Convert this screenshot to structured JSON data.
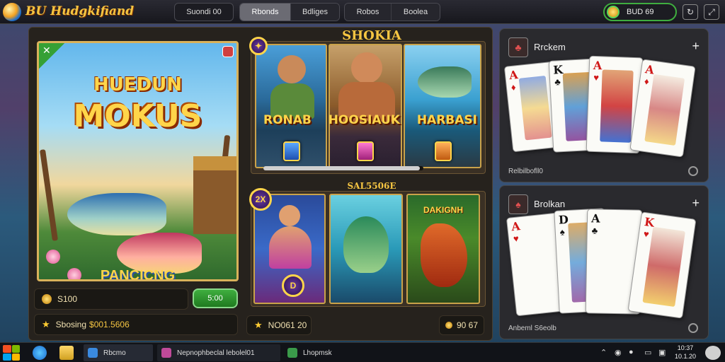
{
  "topbar": {
    "app_name": "BU Hudgkifiand",
    "search_label": "Suondi 00",
    "tabs": [
      "Rbonds",
      "Bdliges"
    ],
    "tabs2": [
      "Robos",
      "Boolea"
    ],
    "coins": "BUD 69"
  },
  "feature": {
    "title_1": "HUEDUN",
    "title_2": "MOKUS",
    "subtitle": "PANCICNG",
    "balance_label": "S100",
    "claim_button": "5:00",
    "bonus_label": "Sbosing",
    "bonus_value": "$001.5606"
  },
  "top_games": {
    "title": "SHOKIA",
    "banner": [
      "RONAB",
      "HOOSIAUK",
      "HARBASI"
    ],
    "progress": 0.98
  },
  "more_games": {
    "title": "SAL5506E",
    "tile1_badge": "2X",
    "tile1_badge2": "D",
    "tile3_title": "DAKIGNH",
    "footer_left": "NO061 20",
    "footer_right": "90 67"
  },
  "panel_1": {
    "title": "Rrckem",
    "footer": "Relbilbofll0"
  },
  "panel_2": {
    "title": "Brolkan",
    "footer": "Anbeml S6eolb"
  },
  "cards_top": [
    {
      "rank": "A",
      "suit": "♦",
      "color": "red"
    },
    {
      "rank": "K",
      "suit": "♣",
      "color": "black"
    },
    {
      "rank": "A",
      "suit": "♥",
      "color": "red"
    },
    {
      "rank": "A",
      "suit": "♦",
      "color": "red"
    }
  ],
  "cards_bottom": [
    {
      "rank": "A",
      "suit": "♥",
      "color": "red"
    },
    {
      "rank": "D",
      "suit": "♠",
      "color": "black"
    },
    {
      "rank": "A",
      "suit": "♣",
      "color": "black"
    },
    {
      "rank": "K",
      "suit": "♥",
      "color": "red"
    }
  ],
  "taskbar": {
    "item_1": "Rbcmo",
    "item_2": "Nepnophbeclal lebolel01",
    "item_3": "Lhopmsk",
    "clock_time": "10:37",
    "clock_date": "10.1.20"
  },
  "colors": {
    "accent_gold": "#f5c542",
    "accent_green": "#3fae3f"
  }
}
